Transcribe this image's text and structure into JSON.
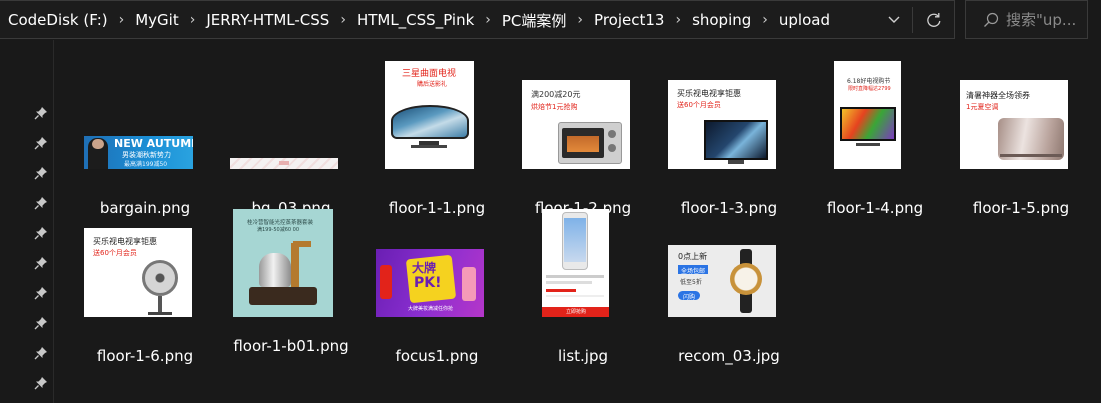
{
  "address_bar": {
    "breadcrumbs": [
      "CodeDisk (F:)",
      "MyGit",
      "JERRY-HTML-CSS",
      "HTML_CSS_Pink",
      "PC端案例",
      "Project13",
      "shoping",
      "upload"
    ]
  },
  "search": {
    "placeholder": "搜索\"up..."
  },
  "icons": {
    "separator": "chevron-right-icon",
    "dropdown": "chevron-down-icon",
    "refresh": "refresh-icon",
    "search": "search-icon",
    "pin": "pin-icon"
  },
  "files": [
    {
      "name": "bargain.png",
      "thumb_text": [
        "NEW AUTUMN",
        "男装潮秋新势力",
        "最高满199减50"
      ]
    },
    {
      "name": "bg_03.png",
      "thumb_text": []
    },
    {
      "name": "floor-1-1.png",
      "thumb_text": [
        "三星曲面电视",
        "購后送影礼"
      ]
    },
    {
      "name": "floor-1-2.png",
      "thumb_text": [
        "满200减20元",
        "烘焙节1元抢购"
      ]
    },
    {
      "name": "floor-1-3.png",
      "thumb_text": [
        "买乐视电视享钜惠",
        "送60个月会员"
      ]
    },
    {
      "name": "floor-1-4.png",
      "thumb_text": [
        "6.18好电视购节",
        "限时直降幅达2799"
      ]
    },
    {
      "name": "floor-1-5.png",
      "thumb_text": [
        "清暑神器全场领券",
        "1元夏空调"
      ]
    },
    {
      "name": "floor-1-6.png",
      "thumb_text": [
        "买乐视电视享钜惠",
        "送60个月会员"
      ]
    },
    {
      "name": "floor-1-b01.png",
      "thumb_text": [
        "桂冷营智能光控蒸茶器套装",
        "满199-50减60 00"
      ]
    },
    {
      "name": "focus1.png",
      "thumb_text": [
        "大牌",
        "PK!",
        "大牌美妆满减任你抢"
      ]
    },
    {
      "name": "list.jpg",
      "thumb_text": [
        "立即抢购"
      ]
    },
    {
      "name": "recom_03.jpg",
      "thumb_text": [
        "0点上新",
        "全场包邮",
        "低至5折",
        "闪购"
      ]
    }
  ],
  "colors": {
    "background": "#191919",
    "border": "#3a3a3a",
    "text": "#ffffff",
    "placeholder": "#8a8a8a",
    "accent_red": "#e2231a",
    "accent_blue": "#2b74e4"
  }
}
